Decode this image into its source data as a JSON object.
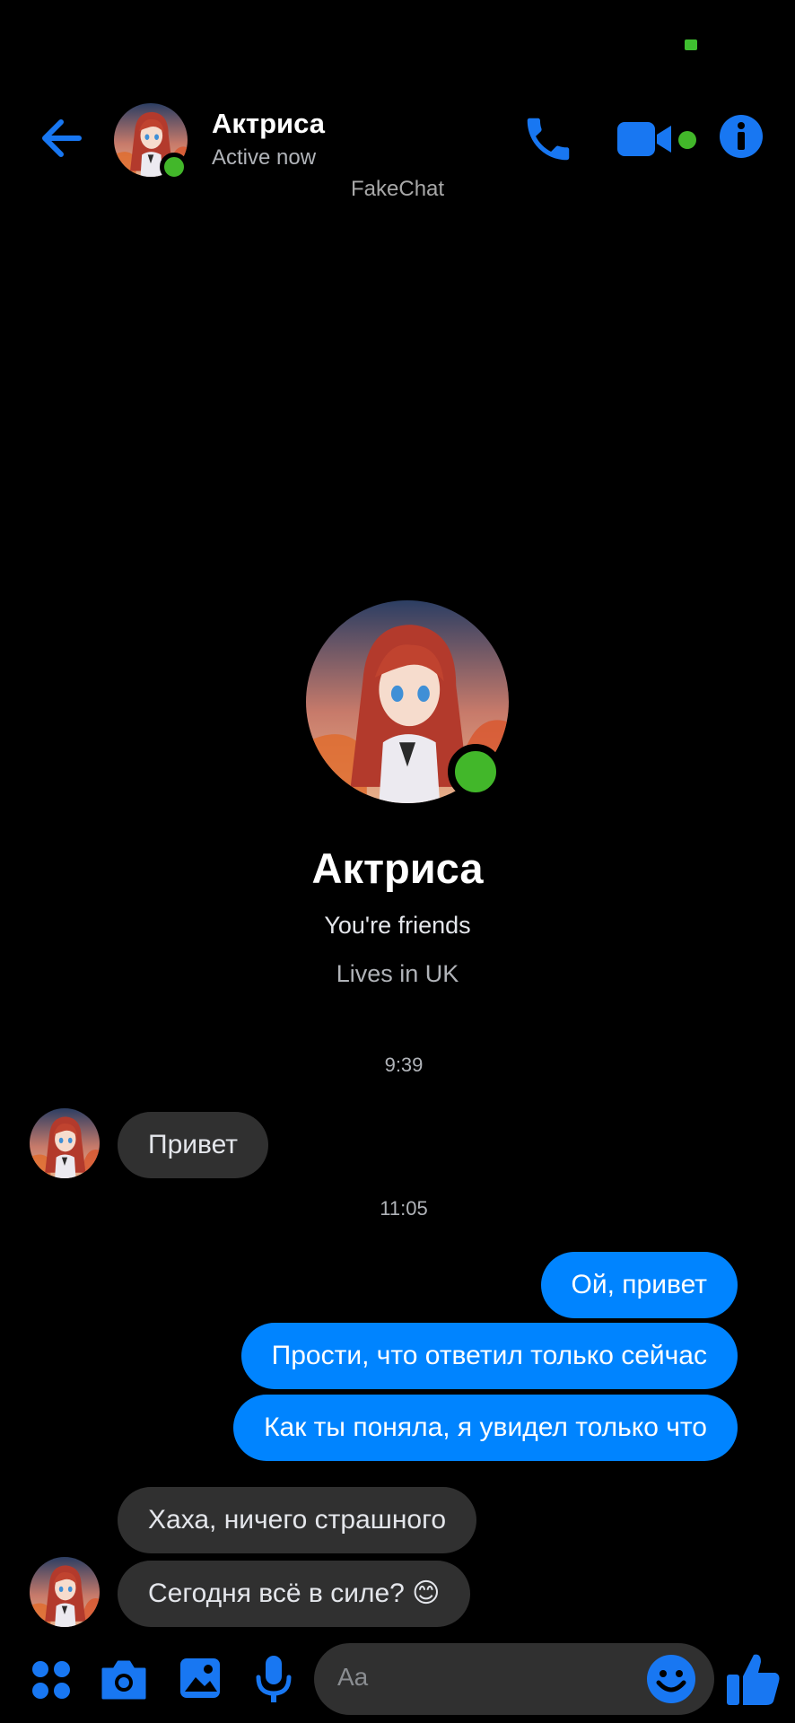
{
  "header": {
    "contact_name": "Актриса",
    "status": "Active now",
    "watermark": "FakeChat"
  },
  "profile": {
    "name": "Актриса",
    "relation": "You're friends",
    "location": "Lives in UK"
  },
  "messages": {
    "timestamp_1": "9:39",
    "timestamp_2": "11:05",
    "incoming_1": "Привет",
    "outgoing_1": "Ой, привет",
    "outgoing_2": "Прости, что ответил только сейчас",
    "outgoing_3": "Как ты поняла, я увидел только что",
    "incoming_2": "Хаха, ничего страшного",
    "incoming_3": "Сегодня всё в силе? 😊"
  },
  "composer": {
    "placeholder": "Aa"
  },
  "icons": {
    "back": "arrow-left-icon",
    "call": "phone-icon",
    "video": "video-camera-icon",
    "info": "info-icon",
    "apps": "four-dots-icon",
    "camera": "camera-icon",
    "gallery": "image-icon",
    "mic": "microphone-icon",
    "emoji": "smiley-icon",
    "like": "thumbs-up-icon"
  },
  "colors": {
    "accent": "#0084ff",
    "online": "#42b72a",
    "incoming_bubble": "#303030",
    "background": "#000000"
  }
}
